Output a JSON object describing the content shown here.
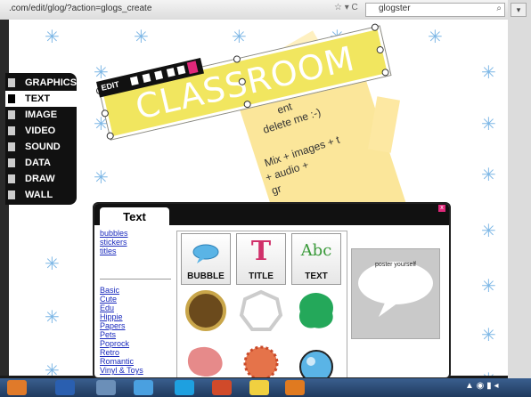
{
  "browser": {
    "url": ".com/edit/glog/?action=glogs_create",
    "search_text": "glogster",
    "url_icons": "☆ ▾ C"
  },
  "tools": [
    {
      "label": "GRAPHICS",
      "icon": "star-icon"
    },
    {
      "label": "TEXT",
      "icon": "text-icon",
      "selected": true
    },
    {
      "label": "IMAGE",
      "icon": "image-icon"
    },
    {
      "label": "VIDEO",
      "icon": "video-icon"
    },
    {
      "label": "SOUND",
      "icon": "sound-icon"
    },
    {
      "label": "DATA",
      "icon": "data-icon"
    },
    {
      "label": "DRAW",
      "icon": "pencil-icon"
    },
    {
      "label": "WALL",
      "icon": "wall-icon"
    }
  ],
  "editbar": {
    "label": "EDIT"
  },
  "banner": {
    "text": "CLASSROOM"
  },
  "note": {
    "line1": "emove any",
    "line2": "ent",
    "line3": "delete me :-)",
    "line4": "Mix + images + t",
    "line5": "+ audio +",
    "line6": "gr"
  },
  "panel": {
    "tab": "Text",
    "close": "x",
    "top_links": [
      "bubbles",
      "stickers",
      "titles"
    ],
    "style_links": [
      "Basic",
      "Cute",
      "Edu",
      "Hippie",
      "Papers",
      "Pets",
      "Poprock",
      "Retro",
      "Romantic",
      "Vinyl & Toys"
    ],
    "tiles": [
      {
        "label": "BUBBLE",
        "icon": "speech-bubble-icon"
      },
      {
        "label": "TITLE",
        "icon": "title-t-icon"
      },
      {
        "label": "TEXT",
        "icon": "abc-text-icon"
      }
    ],
    "tile_glyphs": {
      "title": "T",
      "text": "Abc"
    },
    "preview_text": "poster yourself"
  },
  "colors": {
    "accent_pink": "#e0287a",
    "star": "#7fb8e6",
    "banner": "#f1e65f",
    "note": "#fbe69a"
  },
  "star_glyph": "✳",
  "taskbar": {
    "tray": "▲ ◉ ▮ ◂"
  }
}
